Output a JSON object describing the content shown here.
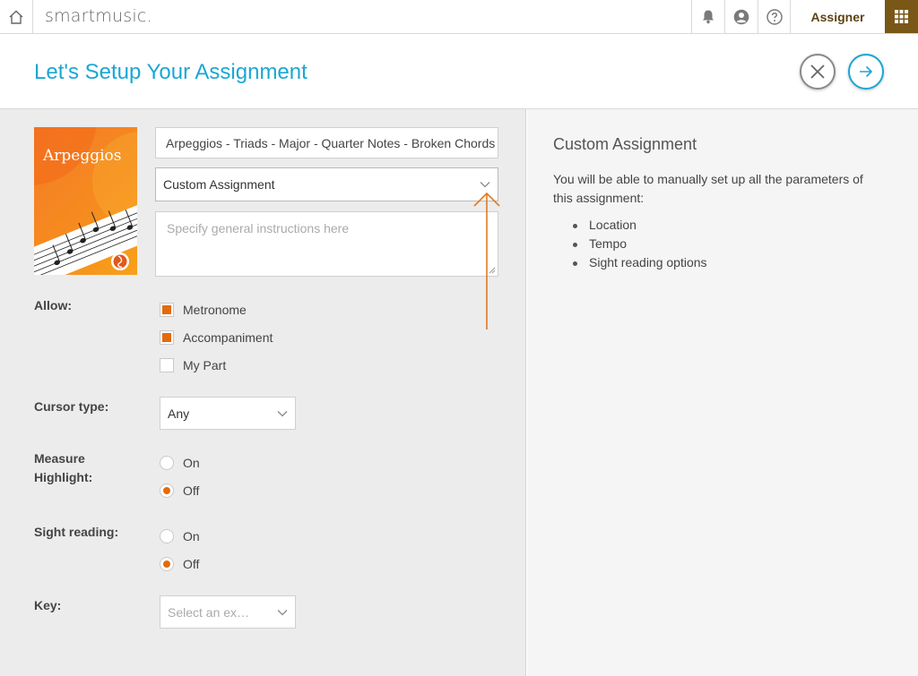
{
  "app": {
    "logo": "smartmusic.",
    "role_label": "Assigner",
    "icons": [
      "home-icon",
      "bell-icon",
      "account-icon",
      "help-icon",
      "apps-grid-icon"
    ]
  },
  "header": {
    "title": "Let's Setup Your Assignment"
  },
  "book": {
    "cover_title": "Arpeggios"
  },
  "form": {
    "title_value": "Arpeggios - Triads - Major - Quarter Notes - Broken Chords",
    "assignment_type": "Custom Assignment",
    "instructions_placeholder": "Specify general instructions here",
    "allow": {
      "label": "Allow:",
      "options": [
        {
          "label": "Metronome",
          "checked": true
        },
        {
          "label": "Accompaniment",
          "checked": true
        },
        {
          "label": "My Part",
          "checked": false
        }
      ]
    },
    "cursor": {
      "label": "Cursor type:",
      "value": "Any"
    },
    "measure_highlight": {
      "label_line1": "Measure",
      "label_line2": "Highlight:",
      "on_label": "On",
      "off_label": "Off",
      "selected": "Off"
    },
    "sight_reading": {
      "label": "Sight reading:",
      "on_label": "On",
      "off_label": "Off",
      "selected": "Off"
    },
    "key": {
      "label": "Key:",
      "placeholder": "Select an ex…"
    }
  },
  "info_panel": {
    "title": "Custom Assignment",
    "description": "You will be able to manually set up all the parameters of this assignment:",
    "items": [
      "Location",
      "Tempo",
      "Sight reading options"
    ]
  },
  "colors": {
    "accent_blue": "#1aa7d4",
    "brand_brown": "#7a5717",
    "orange": "#e36b0a"
  }
}
